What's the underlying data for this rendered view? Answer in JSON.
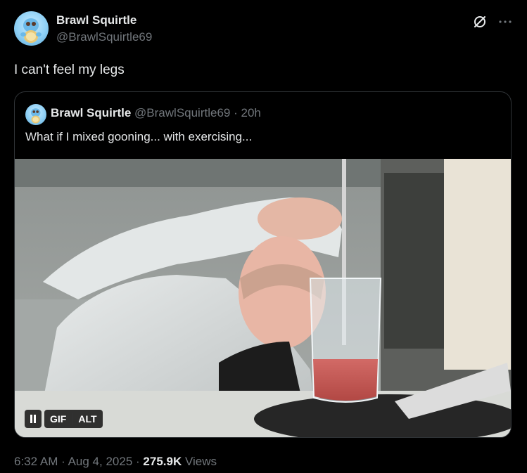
{
  "author": {
    "display_name": "Brawl Squirtle",
    "handle": "@BrawlSquirtle69"
  },
  "post": {
    "text": "I can't feel my legs"
  },
  "quote": {
    "display_name": "Brawl Squirtle",
    "handle": "@BrawlSquirtle69",
    "separator": "·",
    "time": "20h",
    "text": "What if I mixed gooning... with exercising...",
    "media": {
      "gif_label": "GIF",
      "alt_label": "ALT"
    }
  },
  "footer": {
    "time": "6:32 AM",
    "date": "Aug 4, 2025",
    "separator": "·",
    "views_count": "275.9K",
    "views_label": "Views"
  },
  "icons": [
    "avatar",
    "grok-icon",
    "more-icon",
    "pause-icon"
  ],
  "colors": {
    "background": "#000000",
    "text_primary": "#e7e9ea",
    "text_secondary": "#71767b",
    "border": "#2f3336"
  }
}
